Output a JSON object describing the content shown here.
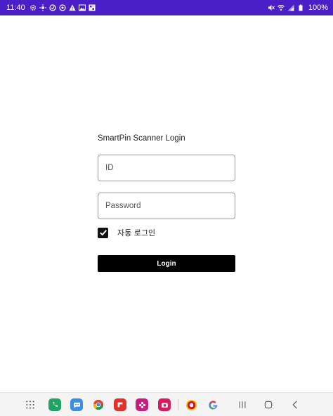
{
  "status_bar": {
    "time": "11:40",
    "battery": "100%",
    "background_color": "#4b1fc8",
    "left_icons": [
      "settings-icon",
      "brightness-icon",
      "vpn-icon",
      "sync-icon",
      "warning-icon",
      "image-icon",
      "qr-icon"
    ],
    "right_icons": [
      "mute-icon",
      "wifi-icon",
      "signal-icon",
      "battery-icon"
    ]
  },
  "login": {
    "title": "SmartPin Scanner Login",
    "id_field": {
      "placeholder": "ID",
      "value": ""
    },
    "password_field": {
      "placeholder": "Password",
      "value": ""
    },
    "auto_login": {
      "label": "자동 로그인",
      "checked": true
    },
    "login_button": "Login"
  },
  "nav_bar": {
    "apps": [
      {
        "name": "app-drawer-icon",
        "color": "#555555"
      },
      {
        "name": "phone-icon",
        "color": "#1fa463"
      },
      {
        "name": "messages-icon",
        "color": "#3a8ee6"
      },
      {
        "name": "chrome-icon",
        "color": "#db4437"
      },
      {
        "name": "flipboard-icon",
        "color": "#e0312b"
      },
      {
        "name": "flower-icon",
        "color": "#c81e7b"
      },
      {
        "name": "camera-icon",
        "color": "#d81b60"
      },
      {
        "name": "lotte-icon",
        "color": "#e4002b"
      },
      {
        "name": "google-icon",
        "color": "#4285f4"
      }
    ],
    "system_buttons": [
      "recents-button",
      "home-button",
      "back-button"
    ]
  }
}
